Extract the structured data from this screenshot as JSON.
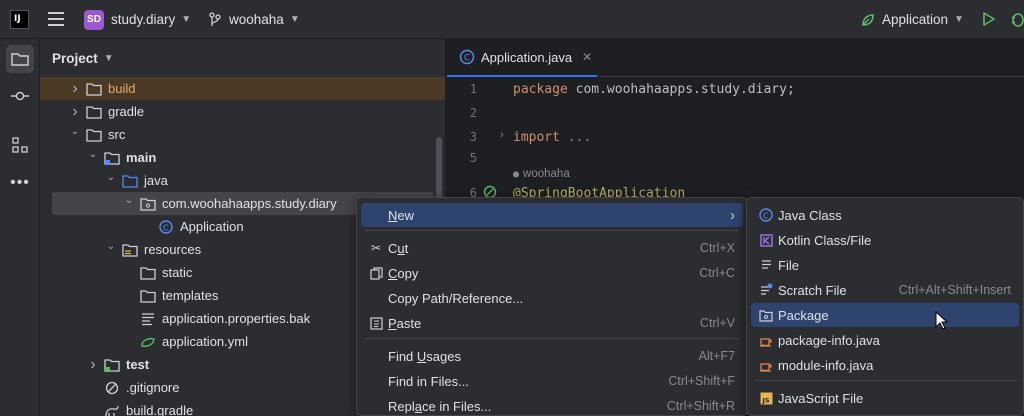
{
  "titlebar": {
    "logo_text": "IJ",
    "project_badge": "SD",
    "project_name": "study.diary",
    "branch": "woohaha",
    "run_config": "Application"
  },
  "project_panel": {
    "title": "Project",
    "tree": [
      {
        "label": "build",
        "icon": "folder-icon",
        "arrow": "›",
        "highlight": "orange"
      },
      {
        "label": "gradle",
        "icon": "folder-icon",
        "arrow": "›"
      },
      {
        "label": "src",
        "icon": "folder-icon",
        "arrow": "⌄"
      },
      {
        "label": "main",
        "icon": "source-folder-icon",
        "arrow": "⌄",
        "bold": true
      },
      {
        "label": "java",
        "icon": "blue-folder-icon",
        "arrow": "⌄"
      },
      {
        "label": "com.woohahaapps.study.diary",
        "icon": "package-icon",
        "arrow": "⌄",
        "highlight": "selected"
      },
      {
        "label": "Application",
        "icon": "spring-class-icon",
        "arrow": ""
      },
      {
        "label": "resources",
        "icon": "resources-folder-icon",
        "arrow": "⌄"
      },
      {
        "label": "static",
        "icon": "folder-icon",
        "arrow": ""
      },
      {
        "label": "templates",
        "icon": "folder-icon",
        "arrow": ""
      },
      {
        "label": "application.properties.bak",
        "icon": "text-file-icon",
        "arrow": ""
      },
      {
        "label": "application.yml",
        "icon": "yaml-icon",
        "arrow": ""
      },
      {
        "label": "test",
        "icon": "test-folder-icon",
        "arrow": "›",
        "bold": true
      },
      {
        "label": ".gitignore",
        "icon": "gitignore-icon",
        "arrow": ""
      },
      {
        "label": "build.gradle",
        "icon": "gradle-icon",
        "arrow": ""
      }
    ]
  },
  "editor": {
    "tab_label": "Application.java",
    "lines": [
      {
        "num": "1",
        "kw": "package",
        "text": " com.woohahaapps.study.diary;"
      },
      {
        "num": "2",
        "kw": "",
        "text": ""
      },
      {
        "num": "3",
        "kw": "import",
        "text": " ..."
      },
      {
        "num": "5",
        "kw": "",
        "text": ""
      },
      {
        "num": "",
        "kw": "",
        "text": "woohaha"
      },
      {
        "num": "6",
        "kw": "",
        "text": "@SpringBootApplication"
      }
    ]
  },
  "context_menu": {
    "items": [
      {
        "label": "New",
        "shortcut": "",
        "icon": "",
        "selected": true,
        "submenu": true
      },
      {
        "label": "Cut",
        "shortcut": "Ctrl+X",
        "icon": "scissors-icon"
      },
      {
        "label": "Copy",
        "shortcut": "Ctrl+C",
        "icon": "copy-icon"
      },
      {
        "label": "Copy Path/Reference...",
        "shortcut": "",
        "icon": ""
      },
      {
        "label": "Paste",
        "shortcut": "Ctrl+V",
        "icon": "paste-icon"
      },
      {
        "label": "Find Usages",
        "shortcut": "Alt+F7",
        "icon": ""
      },
      {
        "label": "Find in Files...",
        "shortcut": "Ctrl+Shift+F",
        "icon": ""
      },
      {
        "label": "Replace in Files...",
        "shortcut": "Ctrl+Shift+R",
        "icon": ""
      }
    ]
  },
  "submenu": {
    "items": [
      {
        "label": "Java Class",
        "shortcut": "",
        "icon": "java-class-icon"
      },
      {
        "label": "Kotlin Class/File",
        "shortcut": "",
        "icon": "kotlin-icon"
      },
      {
        "label": "File",
        "shortcut": "",
        "icon": "file-icon"
      },
      {
        "label": "Scratch File",
        "shortcut": "Ctrl+Alt+Shift+Insert",
        "icon": "scratch-file-icon"
      },
      {
        "label": "Package",
        "shortcut": "",
        "icon": "package-icon",
        "selected": true
      },
      {
        "label": "package-info.java",
        "shortcut": "",
        "icon": "java-file-icon"
      },
      {
        "label": "module-info.java",
        "shortcut": "",
        "icon": "java-file-icon"
      },
      {
        "label": "JavaScript File",
        "shortcut": "",
        "icon": "javascript-icon"
      }
    ]
  },
  "colors": {
    "accent": "#3574f0",
    "menu_selection": "#2e436e",
    "project_badge": "#9b59d0",
    "run_green": "#5fb865"
  }
}
